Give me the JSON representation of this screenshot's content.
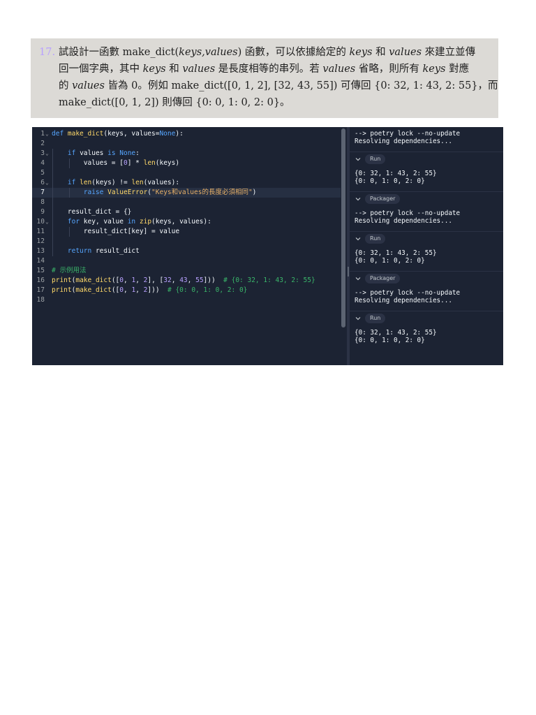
{
  "question": {
    "number": "17.",
    "lines": [
      [
        "試設計一函數 make_dict(",
        "keys,values",
        ") 函數，可以依據給定的 ",
        "keys",
        " 和 ",
        "values",
        " 來建立並傳"
      ],
      [
        "回一個字典，其中 ",
        "keys",
        " 和 ",
        "values",
        " 是長度相等的串列。若 ",
        "values",
        " 省略，則所有 ",
        "keys",
        " 對應"
      ],
      [
        "的 ",
        "values",
        " 皆為 0。例如 make_dict([0, 1, 2], [32, 43, 55]) 可傳回 {0: 32, 1: 43, 2: 55}，而"
      ],
      [
        "make_dict([0, 1, 2]) 則傳回 {0: 0, 1: 0, 2: 0}。"
      ]
    ]
  },
  "editor": {
    "active_line": 7,
    "lines": [
      {
        "n": "1",
        "fold": true,
        "indent": 0,
        "tokens": [
          [
            "kw",
            "def "
          ],
          [
            "fn",
            "make_dict"
          ],
          [
            "",
            "(keys, values="
          ],
          [
            "kw",
            "None"
          ],
          [
            "",
            "):"
          ]
        ]
      },
      {
        "n": "2",
        "fold": false,
        "indent": 0,
        "tokens": []
      },
      {
        "n": "3",
        "fold": true,
        "indent": 1,
        "tokens": [
          [
            "kw",
            "if "
          ],
          [
            "",
            "values "
          ],
          [
            "kw",
            "is None"
          ],
          [
            "",
            ":"
          ]
        ]
      },
      {
        "n": "4",
        "fold": false,
        "indent": 2,
        "tokens": [
          [
            "",
            "values = ["
          ],
          [
            "num",
            "0"
          ],
          [
            "",
            "] * "
          ],
          [
            "bi",
            "len"
          ],
          [
            "",
            "(keys)"
          ]
        ]
      },
      {
        "n": "5",
        "fold": false,
        "indent": 1,
        "tokens": []
      },
      {
        "n": "6",
        "fold": true,
        "indent": 1,
        "tokens": [
          [
            "kw",
            "if "
          ],
          [
            "bi",
            "len"
          ],
          [
            "",
            "(keys) != "
          ],
          [
            "bi",
            "len"
          ],
          [
            "",
            "(values):"
          ]
        ]
      },
      {
        "n": "7",
        "fold": false,
        "indent": 2,
        "tokens": [
          [
            "kw",
            "raise "
          ],
          [
            "fn",
            "ValueError"
          ],
          [
            "",
            "("
          ],
          [
            "str",
            "\"Keys和values的長度必須相同\""
          ],
          [
            "",
            ")"
          ]
        ]
      },
      {
        "n": "8",
        "fold": false,
        "indent": 1,
        "tokens": []
      },
      {
        "n": "9",
        "fold": false,
        "indent": 1,
        "tokens": [
          [
            "",
            "result_dict = {}"
          ]
        ]
      },
      {
        "n": "10",
        "fold": true,
        "indent": 1,
        "tokens": [
          [
            "kw",
            "for "
          ],
          [
            "",
            "key, value "
          ],
          [
            "kw",
            "in "
          ],
          [
            "bi",
            "zip"
          ],
          [
            "",
            "(keys, values):"
          ]
        ]
      },
      {
        "n": "11",
        "fold": false,
        "indent": 2,
        "tokens": [
          [
            "",
            "result_dict[key] = value"
          ]
        ]
      },
      {
        "n": "12",
        "fold": false,
        "indent": 1,
        "tokens": []
      },
      {
        "n": "13",
        "fold": false,
        "indent": 1,
        "tokens": [
          [
            "kw",
            "return "
          ],
          [
            "",
            "result_dict"
          ]
        ]
      },
      {
        "n": "14",
        "fold": false,
        "indent": 0,
        "tokens": []
      },
      {
        "n": "15",
        "fold": false,
        "indent": 0,
        "tokens": [
          [
            "cm",
            "# 示例用法"
          ]
        ]
      },
      {
        "n": "16",
        "fold": false,
        "indent": 0,
        "tokens": [
          [
            "bi",
            "print"
          ],
          [
            "",
            "("
          ],
          [
            "fn",
            "make_dict"
          ],
          [
            "",
            "(["
          ],
          [
            "num",
            "0"
          ],
          [
            "",
            ", "
          ],
          [
            "num",
            "1"
          ],
          [
            "",
            ", "
          ],
          [
            "num",
            "2"
          ],
          [
            "",
            "], ["
          ],
          [
            "num",
            "32"
          ],
          [
            "",
            ", "
          ],
          [
            "num",
            "43"
          ],
          [
            "",
            ", "
          ],
          [
            "num",
            "55"
          ],
          [
            "",
            "]))  "
          ],
          [
            "cm",
            "# {0: 32, 1: 43, 2: 55}"
          ]
        ]
      },
      {
        "n": "17",
        "fold": false,
        "indent": 0,
        "tokens": [
          [
            "bi",
            "print"
          ],
          [
            "",
            "("
          ],
          [
            "fn",
            "make_dict"
          ],
          [
            "",
            "(["
          ],
          [
            "num",
            "0"
          ],
          [
            "",
            ", "
          ],
          [
            "num",
            "1"
          ],
          [
            "",
            ", "
          ],
          [
            "num",
            "2"
          ],
          [
            "",
            "]))  "
          ],
          [
            "cm",
            "# {0: 0, 1: 0, 2: 0}"
          ]
        ]
      },
      {
        "n": "18",
        "fold": false,
        "indent": 0,
        "tokens": []
      }
    ]
  },
  "console": {
    "blocks": [
      {
        "type": "output",
        "lines": [
          "--> poetry lock --no-update",
          "Resolving dependencies..."
        ]
      },
      {
        "type": "header",
        "label": "Run"
      },
      {
        "type": "output",
        "lines": [
          "{0: 32, 1: 43, 2: 55}",
          "{0: 0, 1: 0, 2: 0}"
        ]
      },
      {
        "type": "header",
        "label": "Packager"
      },
      {
        "type": "output",
        "lines": [
          "--> poetry lock --no-update",
          "Resolving dependencies..."
        ]
      },
      {
        "type": "header",
        "label": "Run"
      },
      {
        "type": "output",
        "lines": [
          "{0: 32, 1: 43, 2: 55}",
          "{0: 0, 1: 0, 2: 0}"
        ]
      },
      {
        "type": "header",
        "label": "Packager"
      },
      {
        "type": "output",
        "lines": [
          "--> poetry lock --no-update",
          "Resolving dependencies..."
        ]
      },
      {
        "type": "header",
        "label": "Run"
      },
      {
        "type": "output",
        "lines": [
          "{0: 32, 1: 43, 2: 55}",
          "{0: 0, 1: 0, 2: 0}"
        ]
      }
    ]
  },
  "colors": {
    "editor_bg": "#1c2333",
    "keyword": "#56a6ff",
    "function": "#ffd96a",
    "string": "#e8b168",
    "comment": "#3ab66a",
    "number": "#b8a1ff"
  }
}
